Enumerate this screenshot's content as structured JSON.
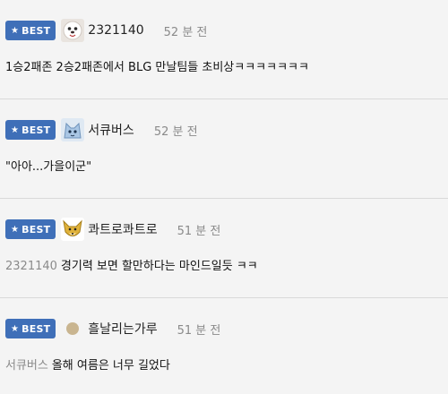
{
  "badge_label": "BEST",
  "colors": {
    "badge_bg": "#3f6fb8",
    "time": "#8a8a8a",
    "mention": "#8a8a8a"
  },
  "comments": [
    {
      "avatar": "white-fluffy-dog-avatar",
      "nickname": "2321140",
      "time": "52 분 전",
      "mention": "",
      "text": "1승2패존 2승2패존에서 BLG 만날팀들 초비상ㅋㅋㅋㅋㅋㅋㅋ"
    },
    {
      "avatar": "blue-cat-avatar",
      "nickname": "서큐버스",
      "time": "52 분 전",
      "mention": "",
      "text": "\"아아...가을이군\""
    },
    {
      "avatar": "fox-avatar",
      "nickname": "콰트로콰트로",
      "time": "51 분 전",
      "mention": "2321140",
      "text": "경기력 보면 할만하다는 마인드일듯 ㅋㅋ"
    },
    {
      "avatar": "beige-dot-avatar",
      "nickname": "흘날리는가루",
      "time": "51 분 전",
      "mention": "서큐버스",
      "text": "올해 여름은 너무 길었다"
    }
  ]
}
